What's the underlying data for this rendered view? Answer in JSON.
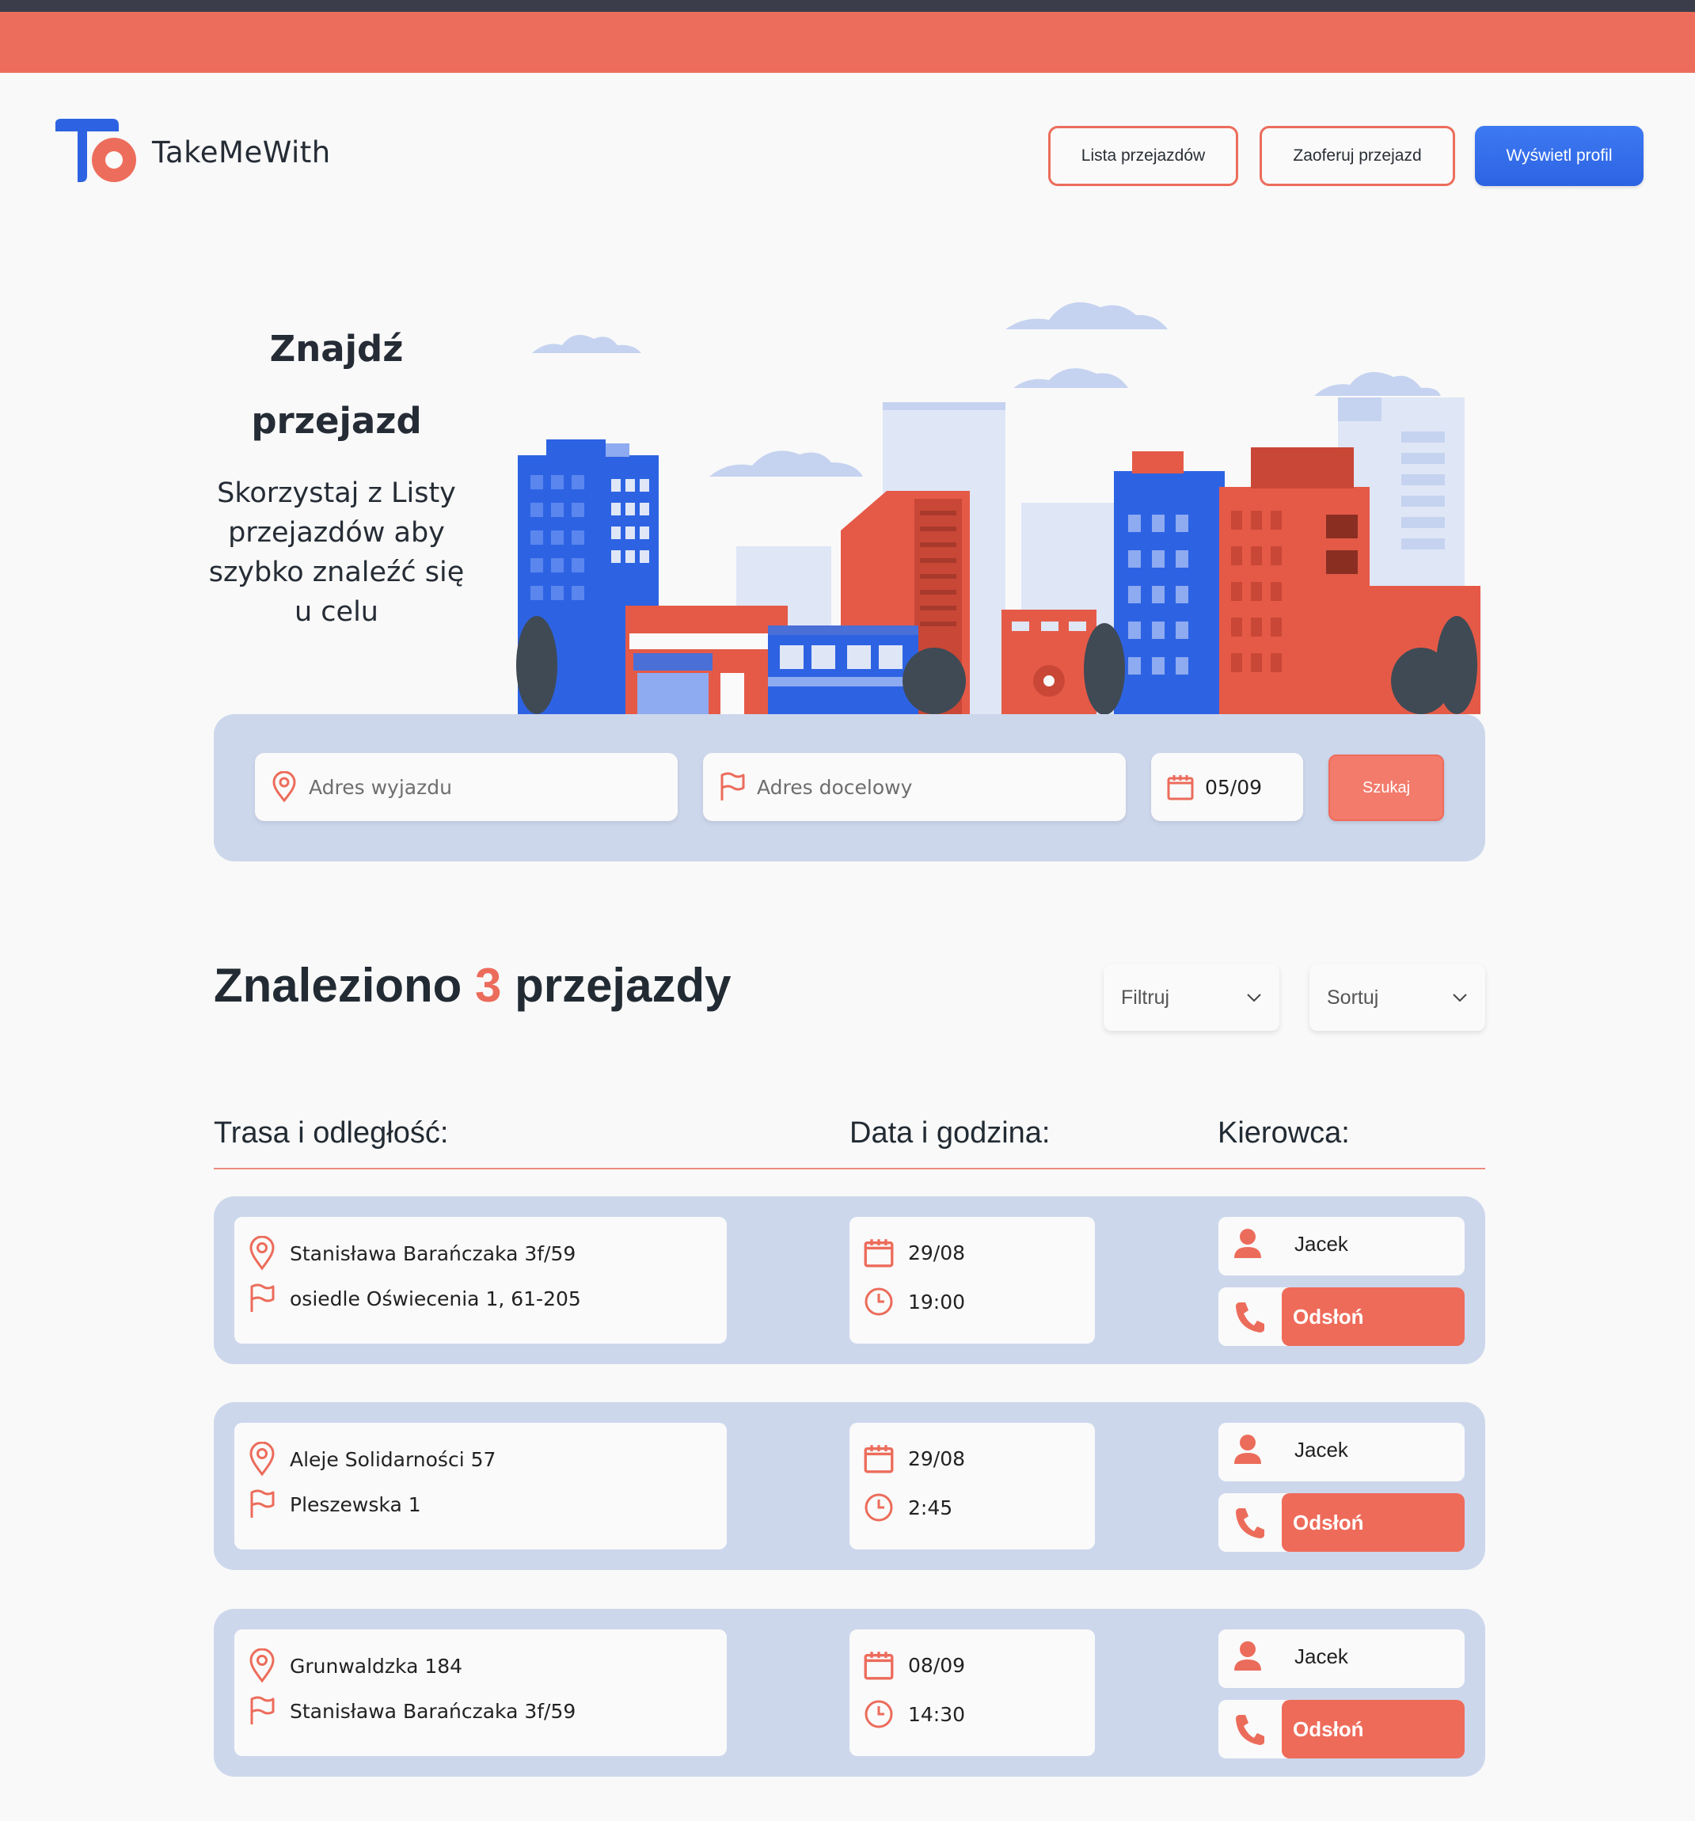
{
  "brand": {
    "name": "TakeMeWith"
  },
  "nav": {
    "list_label": "Lista przejazdów",
    "offer_label": "Zaoferuj przejazd",
    "profile_label": "Wyświetl profil"
  },
  "hero": {
    "title_line1": "Znajdź",
    "title_line2": "przejazd",
    "subtitle_line1": "Skorzystaj z Listy",
    "subtitle_line2": "przejazdów aby",
    "subtitle_line3": "szybko znaleźć się",
    "subtitle_line4": "u celu"
  },
  "search": {
    "from_placeholder": "Adres wyjazdu",
    "to_placeholder": "Adres docelowy",
    "date_value": "05/09",
    "submit_label": "Szukaj"
  },
  "results": {
    "prefix": "Znaleziono",
    "count": "3",
    "suffix": "przejazdy",
    "filter_label": "Filtruj",
    "sort_label": "Sortuj"
  },
  "columns": {
    "route": "Trasa i odległość:",
    "datetime": "Data i godzina:",
    "driver": "Kierowca:"
  },
  "rides": [
    {
      "from": "Stanisława Barańczaka 3f/59",
      "to": "osiedle Oświecenia 1, 61-205",
      "date": "29/08",
      "time": "19:00",
      "driver": "Jacek",
      "reveal": "Odsłoń"
    },
    {
      "from": "Aleje Solidarności 57",
      "to": "Pleszewska 1",
      "date": "29/08",
      "time": "2:45",
      "driver": "Jacek",
      "reveal": "Odsłoń"
    },
    {
      "from": "Grunwaldzka 184",
      "to": "Stanisława Barańczaka 3f/59",
      "date": "08/09",
      "time": "14:30",
      "driver": "Jacek",
      "reveal": "Odsłoń"
    }
  ],
  "colors": {
    "accent_coral": "#ed6d5c",
    "primary_blue": "#2d63e3",
    "panel_blue": "#cdd7ec",
    "text_dark": "#222b33"
  },
  "icons": {
    "from": "location-pin-icon",
    "to": "flag-icon",
    "date": "calendar-icon",
    "time": "clock-icon",
    "driver": "user-icon",
    "reveal": "phone-icon"
  }
}
